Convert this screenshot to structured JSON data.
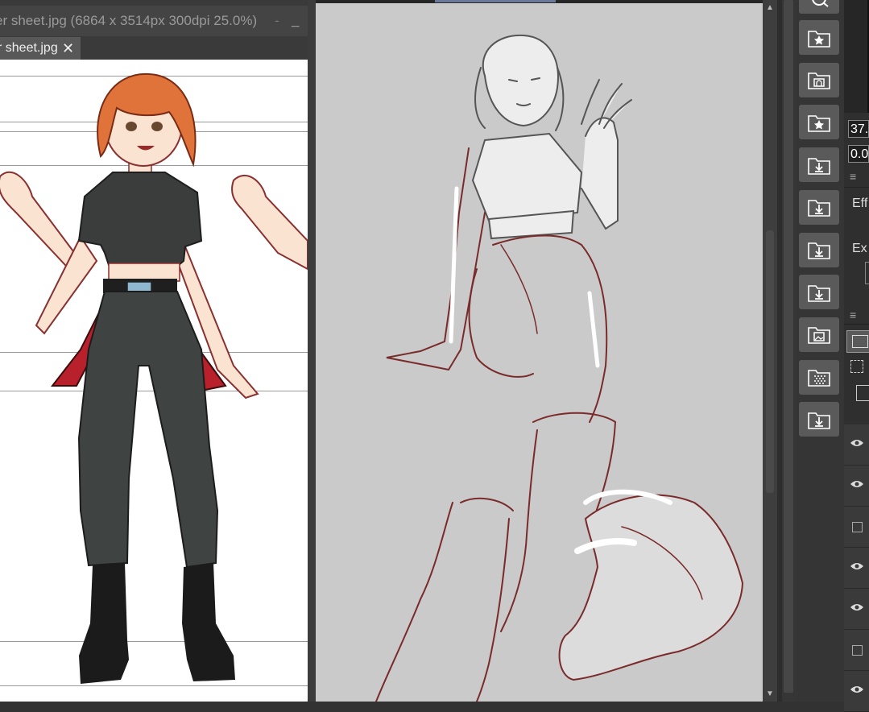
{
  "left_window": {
    "title": "er sheet.jpg (6864 x 3514px 300dpi 25.0%)",
    "title_dash": "-",
    "minimize_icon": "minimize-icon",
    "tab_label": "r sheet.jpg",
    "tab_close": "✕"
  },
  "colors": {
    "hair": "#e0733a",
    "crop_top": "#3b3d3d",
    "pants": "#3f4443",
    "boots": "#1b1b1b",
    "accent_red": "#b8202b",
    "sketch_line": "#7a2a2a",
    "sketch_bg": "#cacaca",
    "ui_button": "#5a5a5a"
  },
  "material_icons": [
    "material-star-folder-icon",
    "material-image-folder-icon",
    "material-star-folder-icon",
    "material-download-folder-icon",
    "material-download-folder-icon",
    "material-download-folder-icon",
    "material-download-folder-icon",
    "material-picture-folder-icon",
    "material-tone-folder-icon",
    "material-download-folder-icon"
  ],
  "right_panel": {
    "value_1": "37.",
    "value_2": "0.0",
    "effect_label": "Eff",
    "expression_label": "Ex",
    "layers": [
      {
        "visibility": "eye"
      },
      {
        "visibility": "eye"
      },
      {
        "visibility": "box"
      },
      {
        "visibility": "eye"
      },
      {
        "visibility": "eye"
      },
      {
        "visibility": "box"
      },
      {
        "visibility": "eye"
      }
    ]
  }
}
